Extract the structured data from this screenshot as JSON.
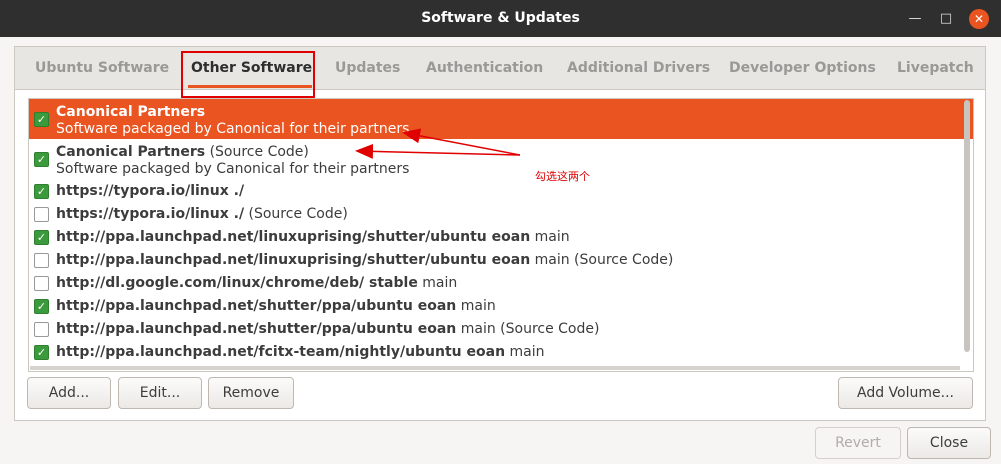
{
  "window": {
    "title": "Software & Updates",
    "controls": {
      "minimize": "—",
      "maximize": "□",
      "close": "✕"
    }
  },
  "tabs": [
    {
      "label": "Ubuntu Software"
    },
    {
      "label": "Other Software"
    },
    {
      "label": "Updates"
    },
    {
      "label": "Authentication"
    },
    {
      "label": "Additional Drivers"
    },
    {
      "label": "Developer Options"
    },
    {
      "label": "Livepatch"
    }
  ],
  "sources": [
    {
      "title": "Canonical Partners",
      "suffix": "",
      "subtitle": "Software packaged by Canonical for their partners",
      "checked": true,
      "selected": true
    },
    {
      "title": "Canonical Partners",
      "suffix": " (Source Code)",
      "subtitle": "Software packaged by Canonical for their partners",
      "checked": true,
      "selected": false
    },
    {
      "title": "https://typora.io/linux ./",
      "suffix": "",
      "checked": true
    },
    {
      "title": "https://typora.io/linux ./",
      "suffix": " (Source Code)",
      "checked": false
    },
    {
      "title": "http://ppa.launchpad.net/linuxuprising/shutter/ubuntu eoan",
      "suffix": " main",
      "checked": true
    },
    {
      "title": "http://ppa.launchpad.net/linuxuprising/shutter/ubuntu eoan",
      "suffix": " main (Source Code)",
      "checked": false
    },
    {
      "title": "http://dl.google.com/linux/chrome/deb/ stable",
      "suffix": " main",
      "checked": false
    },
    {
      "title": "http://ppa.launchpad.net/shutter/ppa/ubuntu eoan",
      "suffix": " main",
      "checked": true
    },
    {
      "title": "http://ppa.launchpad.net/shutter/ppa/ubuntu eoan",
      "suffix": " main (Source Code)",
      "checked": false
    },
    {
      "title": "http://ppa.launchpad.net/fcitx-team/nightly/ubuntu eoan",
      "suffix": " main",
      "checked": true
    }
  ],
  "buttons": {
    "add": "Add...",
    "edit": "Edit...",
    "remove": "Remove",
    "add_volume": "Add Volume...",
    "revert": "Revert",
    "close": "Close"
  },
  "annotation": {
    "text": "勾选这两个"
  },
  "colors": {
    "accent": "#e95420",
    "check": "#3b9a3b",
    "annotation": "#e00000"
  }
}
